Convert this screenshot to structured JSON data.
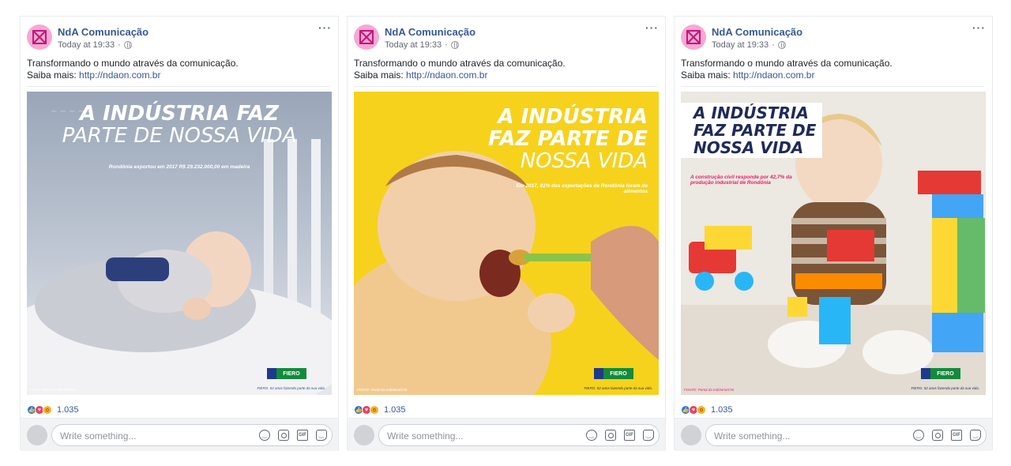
{
  "posts": [
    {
      "page_name": "NdA Comunicação",
      "timestamp": "Today at 19:33",
      "text_line1": "Transformando o mundo através da comunicação.",
      "text_line2_prefix": "Saiba mais:",
      "link": "http://ndaon.com.br",
      "image": {
        "headline_line1": "A INDÚSTRIA FAZ",
        "headline_line2": "PARTE DE NOSSA VIDA",
        "subtext": "Rondônia exportou em 2017 R$ 29.232.000,00 em madeira",
        "source": "Fonte: MDIC/Receita Federal",
        "logo_label": "FIERO",
        "tagline": "FIERO. 52 anos fazendo parte da sua vida.",
        "headline_color": "#ffffff",
        "bg_color": "#aeb8c6"
      },
      "reaction_count": "1.035",
      "comment_placeholder": "Write something..."
    },
    {
      "page_name": "NdA Comunicação",
      "timestamp": "Today at 19:33",
      "text_line1": "Transformando o mundo através da comunicação.",
      "text_line2_prefix": "Saiba mais:",
      "link": "http://ndaon.com.br",
      "image": {
        "headline_line1": "A INDÚSTRIA",
        "headline_line2": "FAZ PARTE DE",
        "headline_line3": "NOSSA VIDA",
        "subtext": "Em 2017, 81% das exportações de Rondônia foram de alimentos",
        "source": "FONTE: Portal da Indústria/CNI",
        "logo_label": "FIERO",
        "tagline": "FIERO. 52 anos fazendo parte da sua vida.",
        "headline_color": "#ffffff",
        "bg_color": "#f6d21c"
      },
      "reaction_count": "1.035",
      "comment_placeholder": "Write something..."
    },
    {
      "page_name": "NdA Comunicação",
      "timestamp": "Today at 19:33",
      "text_line1": "Transformando o mundo através da comunicação.",
      "text_line2_prefix": "Saiba mais:",
      "link": "http://ndaon.com.br",
      "image": {
        "headline_line1": "A INDÚSTRIA",
        "headline_line2": "FAZ PARTE DE",
        "headline_line3": "NOSSA VIDA",
        "subtext": "A construção civil responde por 42,7% da produção industrial de Rondônia",
        "source": "FONTE: Portal da Indústria/CNI",
        "logo_label": "FIERO",
        "tagline": "FIERO. 52 anos fazendo parte da sua vida.",
        "headline_color": "#1e2a5a",
        "bg_color": "#ece8e2"
      },
      "reaction_count": "1.035",
      "comment_placeholder": "Write something..."
    }
  ],
  "colors": {
    "link_blue": "#365899",
    "avatar_pink": "#f7a8d3",
    "like": "#1877f2",
    "love": "#f33e58",
    "wow": "#f7b125",
    "fiero_green": "#138a3c"
  },
  "icons": [
    "more-icon",
    "globe-icon",
    "like-icon",
    "love-icon",
    "wow-icon",
    "emoji-icon",
    "camera-icon",
    "gif-icon",
    "sticker-icon"
  ]
}
